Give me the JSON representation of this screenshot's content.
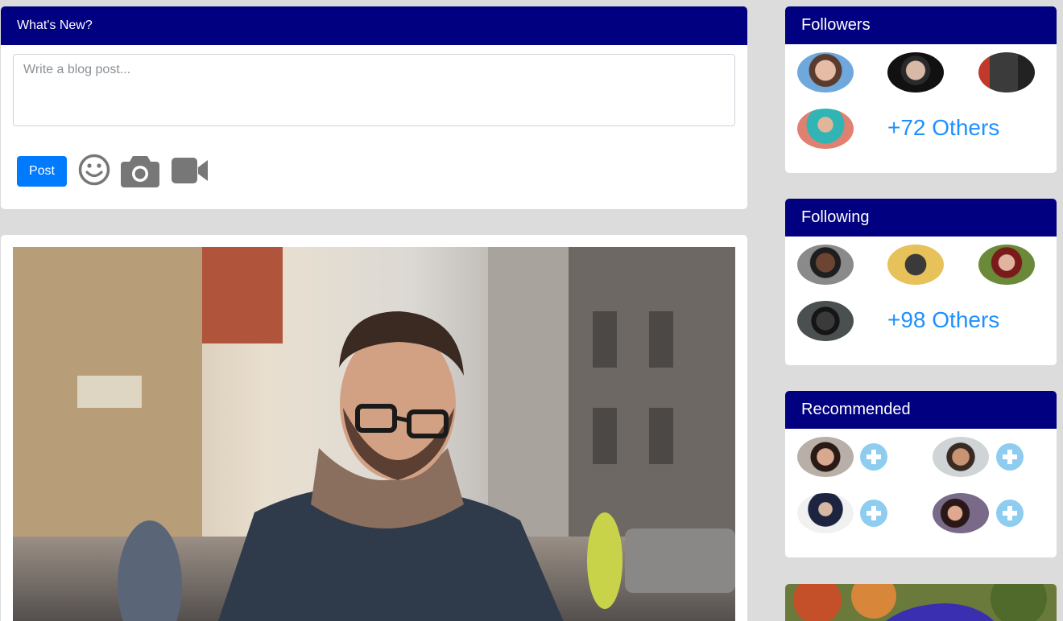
{
  "composer": {
    "title": "What's New?",
    "placeholder": "Write a blog post...",
    "post_label": "Post",
    "icons": [
      "smiley-icon",
      "camera-icon",
      "video-camera-icon"
    ]
  },
  "followers": {
    "title": "Followers",
    "others": "+72 Others"
  },
  "following": {
    "title": "Following",
    "others": "+98 Others"
  },
  "recommended": {
    "title": "Recommended"
  },
  "colors": {
    "header_bg": "#000080",
    "accent": "#007bff",
    "link": "#1e90ff",
    "plus_bg": "#8ecdf0",
    "page_bg": "#dcdcdc"
  }
}
